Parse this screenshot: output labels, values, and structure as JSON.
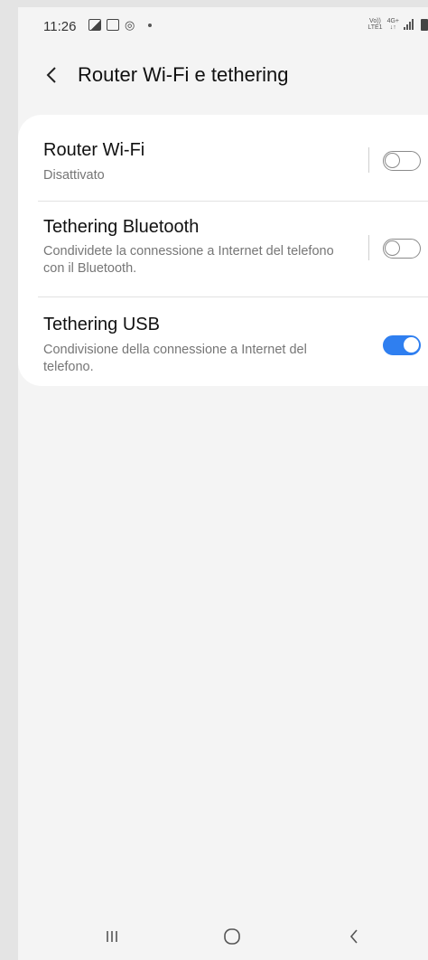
{
  "status_bar": {
    "time": "11:26",
    "left_icons": [
      "gallery-icon",
      "screen-recorder-icon",
      "data-saver-icon",
      "notification-dot-icon"
    ],
    "volte_top": "Vo))",
    "volte_bottom": "LTE1",
    "network_top": "4G+",
    "network_bottom": "↓↑",
    "right_icons": [
      "signal-icon",
      "battery-icon"
    ]
  },
  "header": {
    "title": "Router Wi-Fi e tethering",
    "back_icon": "back-arrow-icon"
  },
  "settings": [
    {
      "title": "Router Wi-Fi",
      "subtitle": "Disattivato",
      "enabled": false
    },
    {
      "title": "Tethering Bluetooth",
      "subtitle": "Condividete la connessione a Internet del telefono con il Bluetooth.",
      "enabled": false
    },
    {
      "title": "Tethering USB",
      "subtitle": "Condivisione della connessione a Internet del telefono.",
      "enabled": true
    }
  ],
  "colors": {
    "accent": "#2f7ff0",
    "background": "#f4f4f4",
    "card": "#ffffff"
  },
  "nav_bar": {
    "recents_icon": "recents-icon",
    "home_icon": "home-icon",
    "back_icon": "nav-back-icon"
  }
}
